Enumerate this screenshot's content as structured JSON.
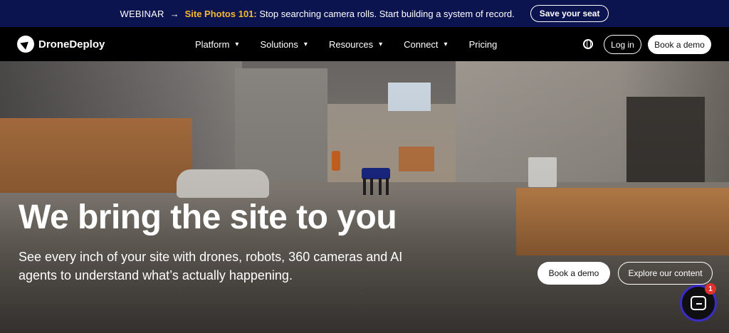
{
  "announcement": {
    "prefix": "WEBINAR",
    "arrow": "→",
    "highlight": "Site Photos 101:",
    "message": "Stop searching camera rolls. Start building a system of record.",
    "cta": "Save your seat",
    "bg_color": "#0c1450",
    "highlight_color": "#f5b82e"
  },
  "nav": {
    "brand": "DroneDeploy",
    "items": [
      {
        "label": "Platform",
        "has_dropdown": true
      },
      {
        "label": "Solutions",
        "has_dropdown": true
      },
      {
        "label": "Resources",
        "has_dropdown": true
      },
      {
        "label": "Connect",
        "has_dropdown": true
      },
      {
        "label": "Pricing",
        "has_dropdown": false
      }
    ],
    "chevron": "▾",
    "globe_icon": "globe-icon",
    "login": "Log in",
    "book_demo": "Book a demo"
  },
  "hero": {
    "title": "We bring the site to you",
    "subtitle": "See every inch of your site with drones, robots, 360 cameras and AI agents to understand what’s actually happening.",
    "primary_cta": "Book a demo",
    "secondary_cta": "Explore our content"
  },
  "chat": {
    "icon": "chat-icon",
    "badge": "1",
    "ring_color": "#3b2cc9",
    "badge_color": "#e0312c"
  }
}
